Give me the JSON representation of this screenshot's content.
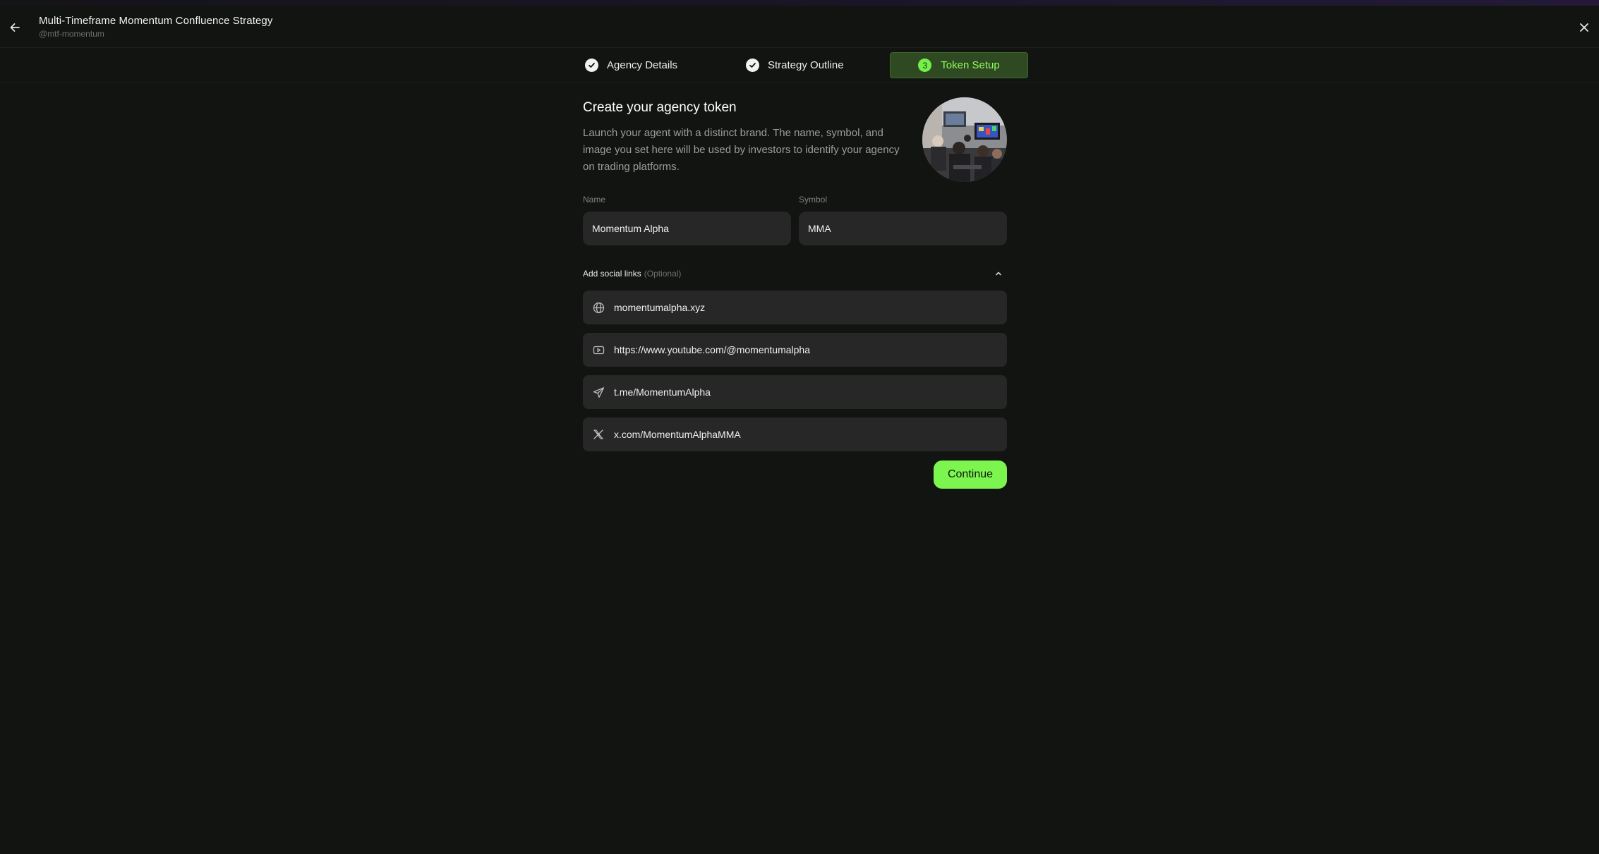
{
  "header": {
    "title": "Multi-Timeframe Momentum Confluence Strategy",
    "handle": "@mtf-momentum",
    "back_icon": "arrow-left-icon",
    "close_icon": "close-icon"
  },
  "steps": [
    {
      "label": "Agency Details",
      "state": "complete"
    },
    {
      "label": "Strategy Outline",
      "state": "complete"
    },
    {
      "label": "Token Setup",
      "state": "active",
      "number": "3"
    }
  ],
  "token": {
    "title": "Create your agency token",
    "description": "Launch your agent with a distinct brand. The name, symbol, and image you set here will be used by investors to identify your agency on trading platforms.",
    "name_label": "Name",
    "name_value": "Momentum Alpha",
    "symbol_label": "Symbol",
    "symbol_value": "MMA"
  },
  "social": {
    "label": "Add social links",
    "optional": "(Optional)",
    "links": [
      {
        "icon": "globe-icon",
        "value": "momentumalpha.xyz"
      },
      {
        "icon": "youtube-icon",
        "value": "https://www.youtube.com/@momentumalpha"
      },
      {
        "icon": "telegram-icon",
        "value": "t.me/MomentumAlpha"
      },
      {
        "icon": "x-icon",
        "value": "x.com/MomentumAlphaMMA"
      }
    ]
  },
  "actions": {
    "continue_label": "Continue"
  },
  "colors": {
    "background": "#121412",
    "accent": "#7cf54f",
    "active_step_bg": "#2f4a23",
    "field_bg": "#262726"
  }
}
